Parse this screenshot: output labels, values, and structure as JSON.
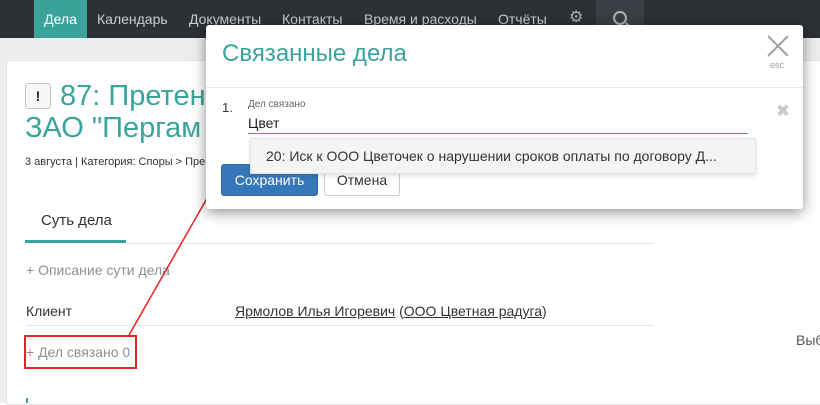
{
  "nav": {
    "items": [
      {
        "label": "Дела",
        "active": true
      },
      {
        "label": "Календарь"
      },
      {
        "label": "Документы"
      },
      {
        "label": "Контакты"
      },
      {
        "label": "Время и расходы"
      },
      {
        "label": "Отчёты"
      }
    ],
    "settings_icon": "gear-icon",
    "search_icon": "search-icon"
  },
  "case": {
    "urgent_mark": "!",
    "title_line1": "87: Претен",
    "title_line2": "ЗАО \"Пергам",
    "meta": "3 августа | Категория: Споры > Пре",
    "tab_label": "Суть дела",
    "add_description": "+ Описание сути дела",
    "client_label": "Клиент",
    "client_name": "Ярмолов Илья Игоревич",
    "client_company": "ООО Цветная радуга",
    "related_link": "+ Дел связано 0",
    "right_truncated": "Выб"
  },
  "modal": {
    "title": "Связанные дела",
    "esc_hint": "esc",
    "row_number": "1.",
    "field_label": "Дел связано",
    "field_value": "Цвет",
    "suggestion": "20: Иск к ООО Цветочек о нарушении сроков оплаты по договору Д...",
    "save_label": "Сохранить",
    "cancel_label": "Отмена"
  },
  "colors": {
    "accent": "#3aa49c",
    "nav_bg": "#2d3035",
    "primary_button": "#3577b8",
    "annotation": "#e02424"
  }
}
